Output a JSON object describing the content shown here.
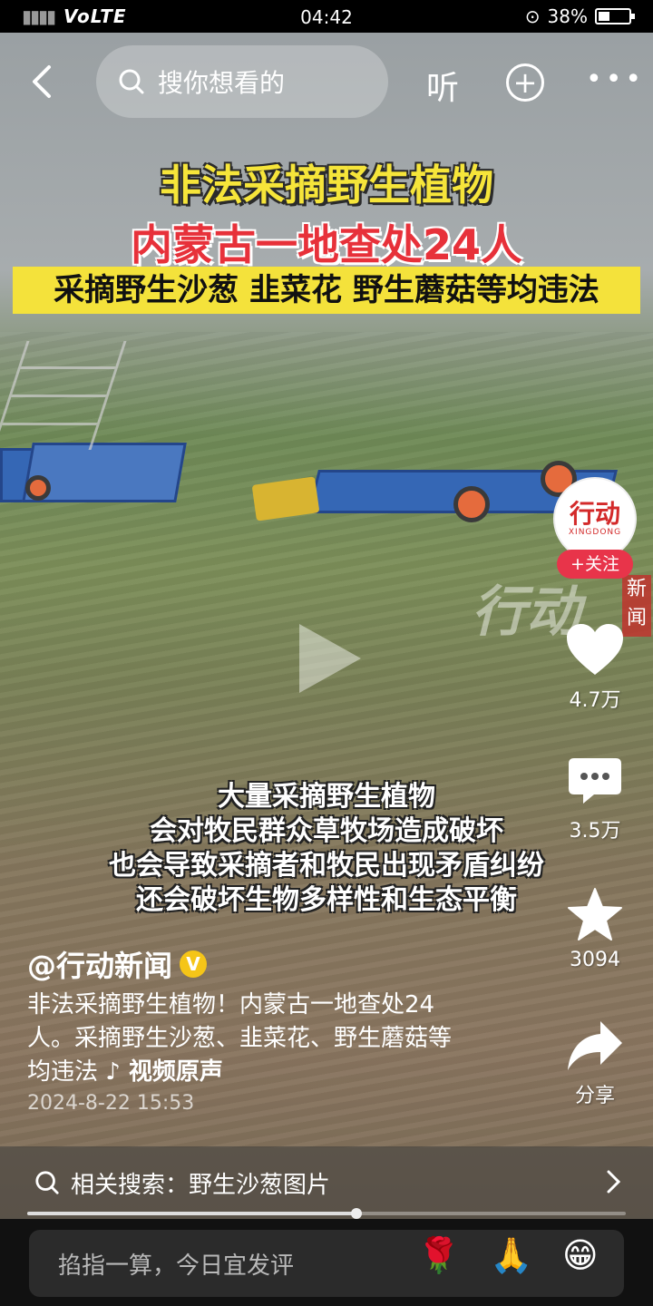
{
  "status": {
    "time": "04:42",
    "network": "VoLTE",
    "battery": "38%"
  },
  "topbar": {
    "search_placeholder": "搜你想看的",
    "listen_label": "听"
  },
  "video": {
    "headline1": "非法采摘野生植物",
    "headline2": "内蒙古一地查处24人",
    "banner": "采摘野生沙葱 韭菜花 野生蘑菇等均违法",
    "watermark": "行动",
    "watermark_tag": "新闻",
    "subtitles": [
      "大量采摘野生植物",
      "会对牧民群众草牧场造成破坏",
      "也会导致采摘者和牧民出现矛盾纠纷",
      "还会破坏生物多样性和生态平衡"
    ],
    "progress": 0.55
  },
  "rail": {
    "avatar_logo": "行动",
    "avatar_sub": "XINGDONG",
    "follow_label": "+关注",
    "likes": "4.7万",
    "comments": "3.5万",
    "favorites": "3094",
    "share": "分享"
  },
  "post": {
    "author": "@行动新闻",
    "verified": "V",
    "desc_line1": "非法采摘野生植物！内蒙古一地查处24",
    "desc_line2": "人。采摘野生沙葱、韭菜花、野生蘑菇等",
    "desc_line3": "均违法",
    "music": "♪ 视频原声",
    "date": "2024-8-22 15:53"
  },
  "related": {
    "label": "相关搜索：",
    "query": "野生沙葱图片"
  },
  "comment": {
    "placeholder": "掐指一算，今日宜发评",
    "emojis": [
      "🌹",
      "🙏",
      "😁"
    ]
  }
}
